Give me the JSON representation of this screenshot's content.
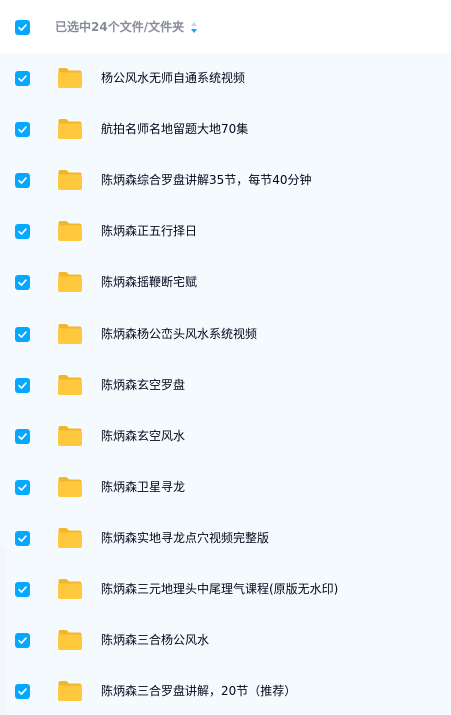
{
  "header": {
    "selection_text": "已选中24个文件/文件夹",
    "select_all_checked": true,
    "sort_icon": "sort-arrows-icon"
  },
  "colors": {
    "accent": "#06a7ff",
    "folder": "#ffc83d",
    "list_bg": "#f5faff",
    "text": "#03081a",
    "muted": "#878c9c"
  },
  "files": [
    {
      "name": "杨公风水无师自通系统视频",
      "checked": true,
      "icon": "folder-icon"
    },
    {
      "name": "航拍名师名地留题大地70集",
      "checked": true,
      "icon": "folder-icon"
    },
    {
      "name": "陈炳森综合罗盘讲解35节，每节40分钟",
      "checked": true,
      "icon": "folder-icon"
    },
    {
      "name": "陈炳森正五行择日",
      "checked": true,
      "icon": "folder-icon"
    },
    {
      "name": "陈炳森摇鞭断宅赋",
      "checked": true,
      "icon": "folder-icon"
    },
    {
      "name": "陈炳森杨公峦头风水系统视频",
      "checked": true,
      "icon": "folder-icon"
    },
    {
      "name": "陈炳森玄空罗盘",
      "checked": true,
      "icon": "folder-icon"
    },
    {
      "name": "陈炳森玄空风水",
      "checked": true,
      "icon": "folder-icon"
    },
    {
      "name": "陈炳森卫星寻龙",
      "checked": true,
      "icon": "folder-icon"
    },
    {
      "name": "陈炳森实地寻龙点穴视频完整版",
      "checked": true,
      "icon": "folder-icon"
    },
    {
      "name": "陈炳森三元地理头中尾理气课程(原版无水印)",
      "checked": true,
      "icon": "folder-icon"
    },
    {
      "name": "陈炳森三合杨公风水",
      "checked": true,
      "icon": "folder-icon"
    },
    {
      "name": "陈炳森三合罗盘讲解，20节（推荐）",
      "checked": true,
      "icon": "folder-icon"
    }
  ]
}
